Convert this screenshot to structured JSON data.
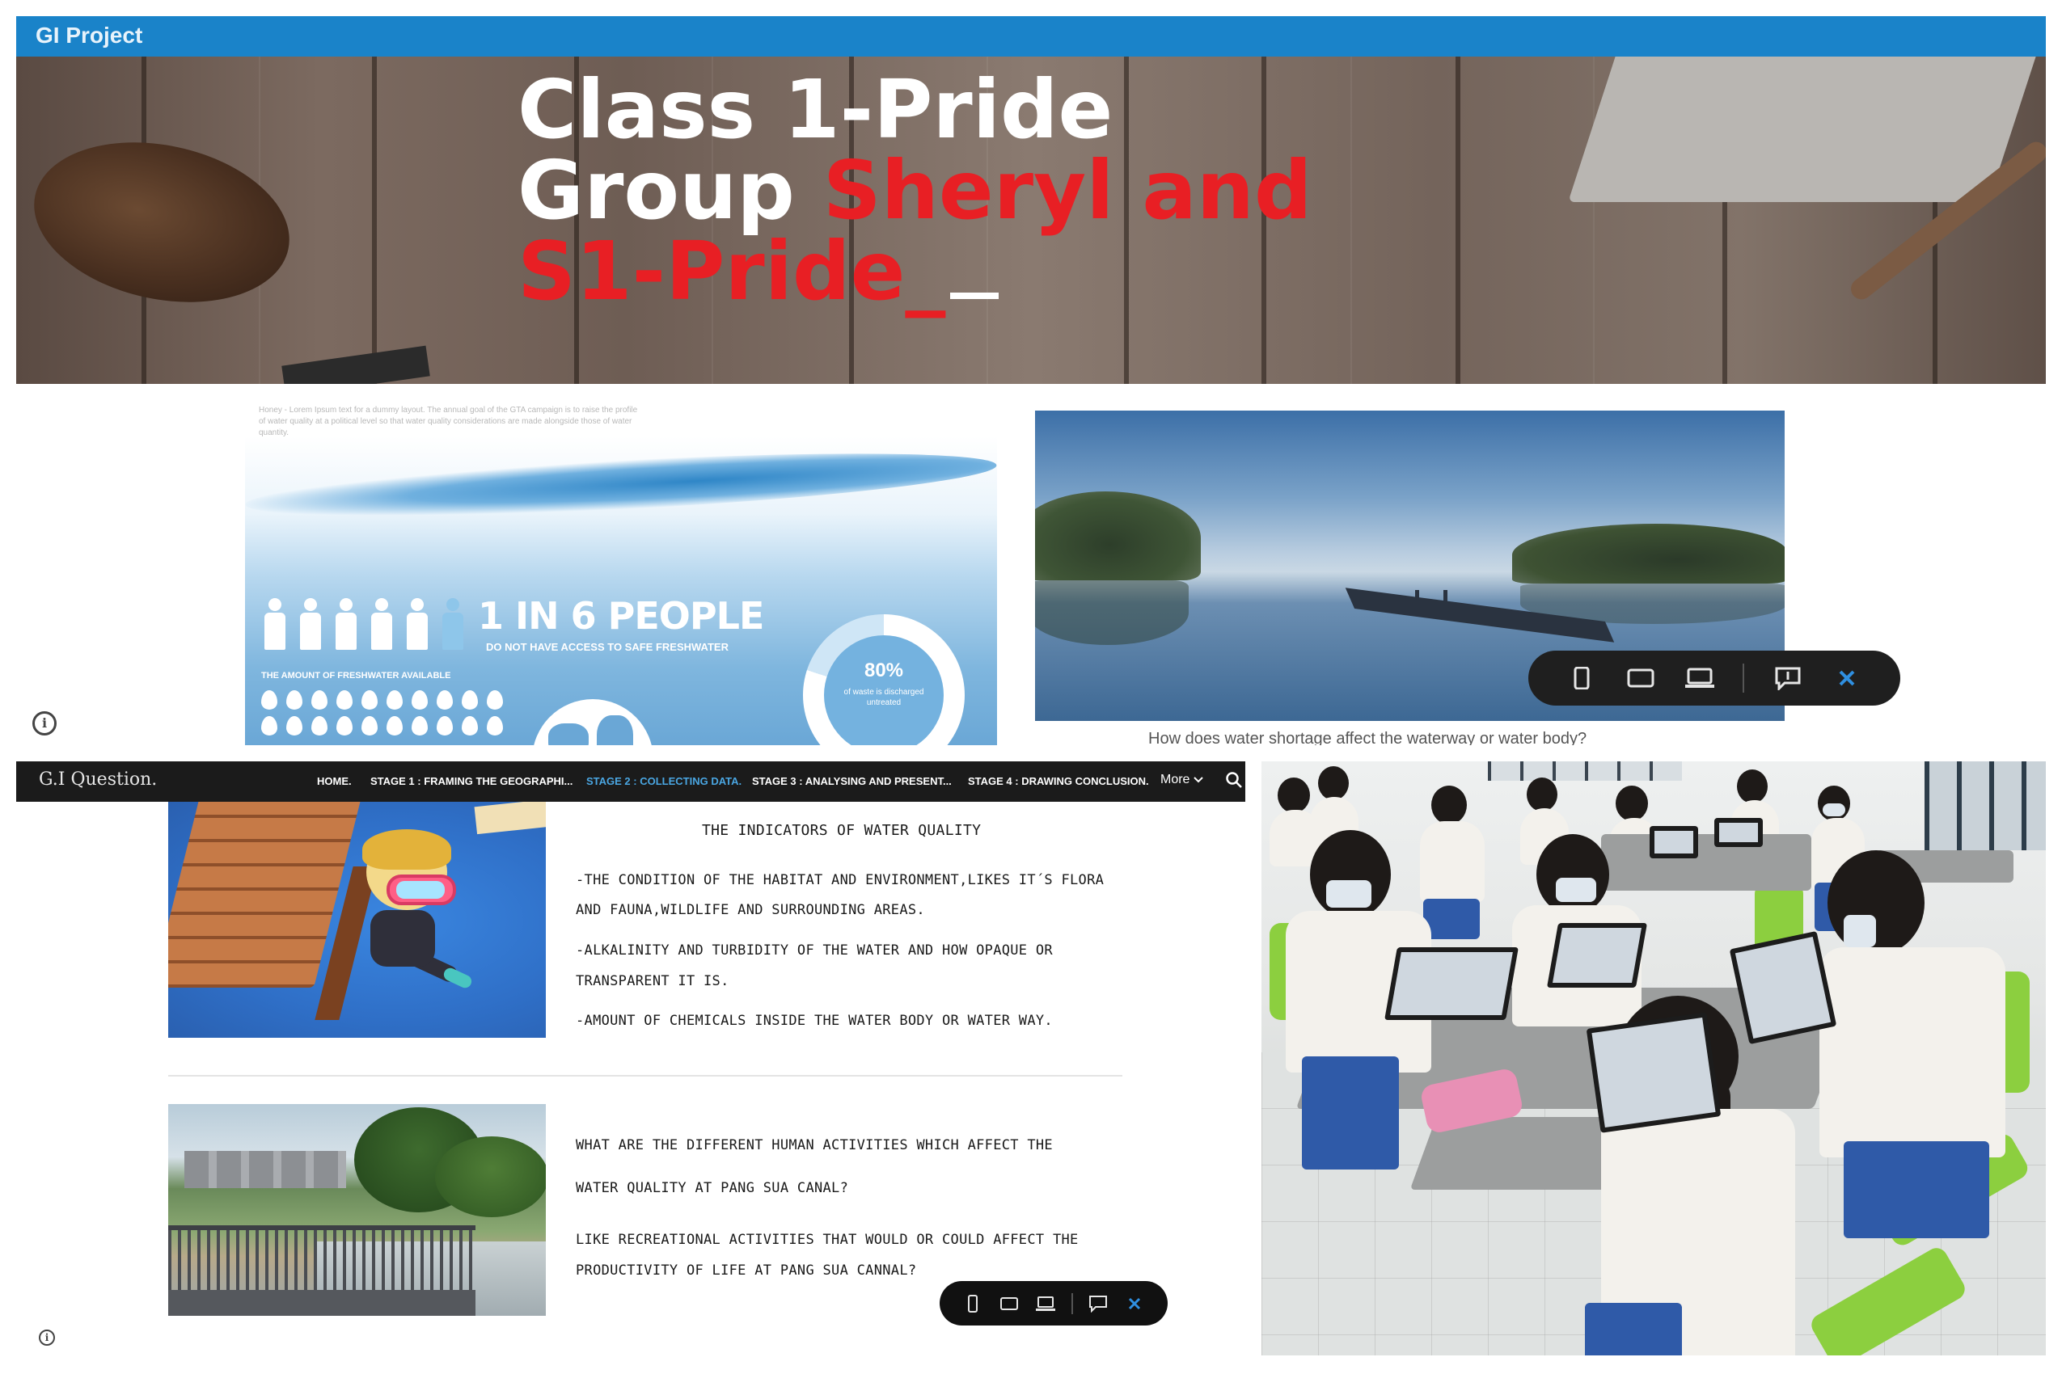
{
  "top": {
    "window_title": "GI Project",
    "banner": {
      "line1": "Class 1-Pride",
      "line2_white": "Group ",
      "line2_red": "Sheryl and",
      "line3_red": "S1-Pride_"
    },
    "faint_text": "Honey - Lorem Ipsum text for a dummy layout. The annual goal of the GTA campaign is to raise the profile of water quality at a political level so that water quality considerations are made alongside those of water quantity.",
    "infographic": {
      "headline": "1 IN 6 PEOPLE",
      "subline": "DO NOT HAVE ACCESS TO SAFE FRESHWATER",
      "freshwater_label": "THE AMOUNT OF FRESHWATER AVAILABLE",
      "donut_pct": "80%",
      "donut_text": "of waste is discharged untreated",
      "donut_fraction": 0.8
    },
    "question": "How does water shortage affect the waterway or water body?"
  },
  "nav": {
    "brand": "G.I Question.",
    "tabs": [
      "HOME.",
      "STAGE 1 : FRAMING THE GEOGRAPHI...",
      "STAGE 2 : COLLECTING DATA.",
      "STAGE 3 : ANALYSING AND PRESENT...",
      "STAGE 4 : DRAWING CONCLUSION."
    ],
    "more": "More"
  },
  "indicators": {
    "title": "THE INDICATORS OF WATER QUALITY",
    "p1a": "-THE CONDITION OF THE HABITAT AND ENVIRONMENT,LIKES IT´S FLORA",
    "p1b": "AND FAUNA,WILDLIFE AND SURROUNDING AREAS.",
    "p2a": "-ALKALINITY AND TURBIDITY OF THE WATER AND HOW OPAQUE OR",
    "p2b": "TRANSPARENT IT IS.",
    "p3": "-AMOUNT OF CHEMICALS INSIDE THE WATER BODY OR WATER WAY."
  },
  "question2": {
    "q1a": "WHAT ARE THE DIFFERENT HUMAN ACTIVITIES WHICH AFFECT THE",
    "q1b": "WATER QUALITY AT PANG SUA CANAL?",
    "q2a": "LIKE RECREATIONAL ACTIVITIES THAT WOULD OR COULD AFFECT THE",
    "q2b": "PRODUCTIVITY OF LIFE AT PANG SUA CANNAL?"
  },
  "toolbar_icons": [
    "phone-preview-icon",
    "tablet-preview-icon",
    "laptop-preview-icon",
    "feedback-icon",
    "close-icon"
  ],
  "colors": {
    "titlebar": "#1a83c9",
    "banner_red": "#e81f24",
    "nav_active": "#4aa6e2",
    "toolbar_bg": "#1f1f1f"
  }
}
